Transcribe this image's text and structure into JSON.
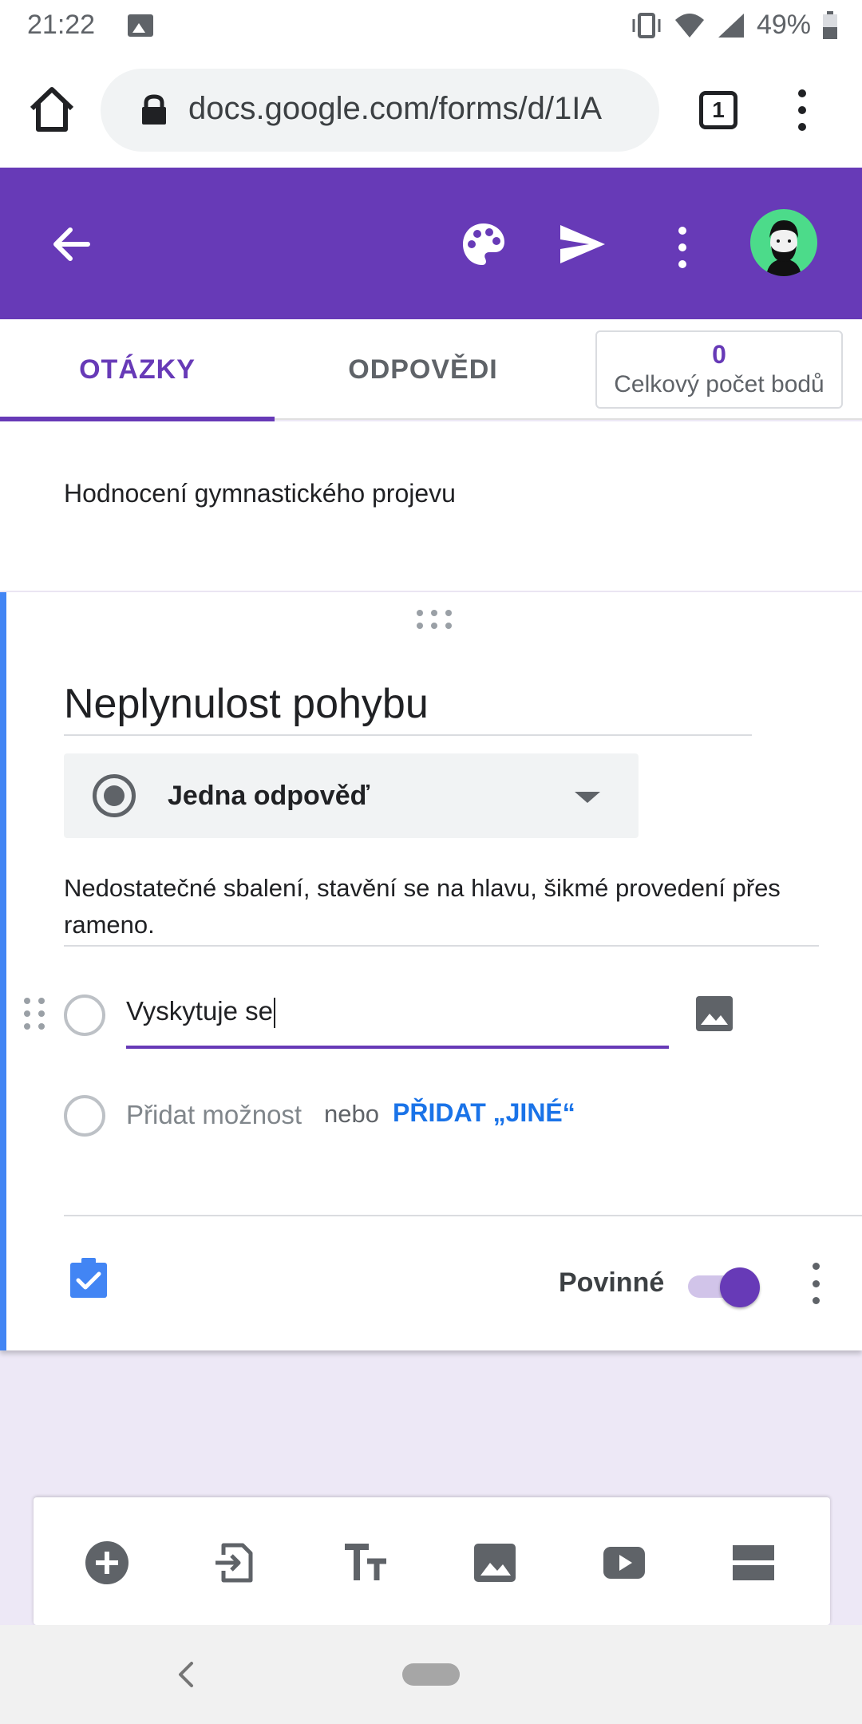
{
  "status_bar": {
    "time": "21:22",
    "battery_percent": "49%",
    "icons": [
      "image-icon",
      "vibrate-icon",
      "wifi-icon",
      "signal-icon",
      "battery-icon"
    ]
  },
  "browser": {
    "url": "docs.google.com/forms/d/1IA",
    "tab_count": "1",
    "icons": [
      "home-icon",
      "lock-icon",
      "tabs-icon",
      "more-vert-icon"
    ]
  },
  "header": {
    "color": "#673ab7",
    "icons": [
      "back-arrow-icon",
      "palette-icon",
      "send-icon",
      "more-vert-icon",
      "avatar"
    ]
  },
  "tabs": {
    "questions": "OTÁZKY",
    "responses": "ODPOVĚDI",
    "active": "questions"
  },
  "points": {
    "value": "0",
    "label": "Celkový počet bodů"
  },
  "section": {
    "title": "Hodnocení gymnastického projevu"
  },
  "question": {
    "title": "Neplynulost pohybu",
    "type_label": "Jedna odpověď",
    "description": "Nedostatečné sbalení, stavění se na hlavu, šikmé provedení přes rameno.",
    "options": [
      {
        "value": "Vyskytuje se"
      }
    ],
    "add_option_placeholder": "Přidat možnost",
    "or_text": "nebo",
    "add_other_label": "PŘIDAT „JINÉ“",
    "required_label": "Povinné",
    "required": true,
    "accent_color": "#4285f4"
  },
  "toolbar": {
    "icons": [
      "add-question-icon",
      "import-questions-icon",
      "add-title-icon",
      "add-image-icon",
      "add-video-icon",
      "add-section-icon"
    ]
  }
}
